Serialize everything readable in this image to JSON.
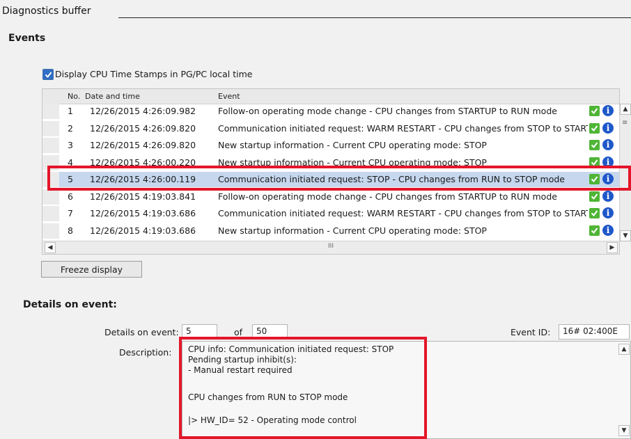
{
  "panel": {
    "title": "Diagnostics buffer",
    "events_heading": "Events"
  },
  "timestamps": {
    "label": "Display CPU Time Stamps in PG/PC local time",
    "checked": true
  },
  "table": {
    "columns": [
      "No.",
      "Date and time",
      "Event"
    ],
    "rows": [
      {
        "no": "1",
        "datetime": "12/26/2015 4:26:09.982",
        "event": "Follow-on operating mode change  - CPU changes from STARTUP to RUN mode"
      },
      {
        "no": "2",
        "datetime": "12/26/2015 4:26:09.820",
        "event": "Communication initiated request: WARM RESTART  - CPU changes from STOP to STARTUP mode"
      },
      {
        "no": "3",
        "datetime": "12/26/2015 4:26:09.820",
        "event": "New startup information  - Current CPU operating mode: STOP"
      },
      {
        "no": "4",
        "datetime": "12/26/2015 4:26:00.220",
        "event": "New startup information  - Current CPU operating mode: STOP"
      },
      {
        "no": "5",
        "datetime": "12/26/2015 4:26:00.119",
        "event": "Communication initiated request: STOP  - CPU changes from RUN to STOP mode"
      },
      {
        "no": "6",
        "datetime": "12/26/2015 4:19:03.841",
        "event": "Follow-on operating mode change  - CPU changes from STARTUP to RUN mode"
      },
      {
        "no": "7",
        "datetime": "12/26/2015 4:19:03.686",
        "event": "Communication initiated request: WARM RESTART  - CPU changes from STOP to STARTUP mode"
      },
      {
        "no": "8",
        "datetime": "12/26/2015 4:19:03.686",
        "event": "New startup information  - Current CPU operating mode: STOP"
      }
    ],
    "selected_row": "5",
    "hscroll_grip": "III"
  },
  "freeze_button": "Freeze display",
  "details": {
    "heading": "Details on event:",
    "event_label": "Details on event:",
    "event_value": "5",
    "of_label": "of",
    "total_value": "50",
    "event_id_label": "Event ID:",
    "event_id_value": "16# 02:400E",
    "description_label": "Description:",
    "description_lines": [
      "CPU info: Communication initiated request: STOP",
      "Pending startup inhibit(s):",
      " - Manual restart required",
      "",
      " CPU changes from RUN to STOP mode",
      "",
      " |> HW_ID=    52 - Operating mode control"
    ]
  },
  "colors": {
    "highlight": "#e3162a",
    "selection": "#c6d7ee",
    "ok_icon": "#4fb536",
    "info_icon": "#1f58c9"
  }
}
